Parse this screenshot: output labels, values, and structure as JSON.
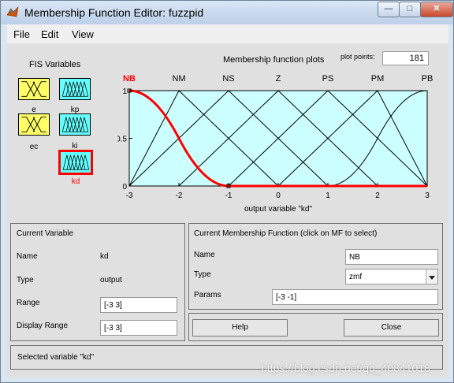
{
  "window": {
    "title": "Membership Function Editor: fuzzpid"
  },
  "title_buttons": {
    "minimize": "—",
    "maximize": "□",
    "close": "✕"
  },
  "menu": [
    {
      "label": "File"
    },
    {
      "label": "Edit"
    },
    {
      "label": "View"
    }
  ],
  "fis": {
    "title": "FIS Variables",
    "variables": [
      {
        "name": "e",
        "type": "input",
        "selected": false
      },
      {
        "name": "kp",
        "type": "output",
        "selected": false
      },
      {
        "name": "ec",
        "type": "input",
        "selected": false
      },
      {
        "name": "ki",
        "type": "output",
        "selected": false
      },
      {
        "name": "kd",
        "type": "output",
        "selected": true
      }
    ]
  },
  "plot": {
    "title": "Membership function plots",
    "plot_points_label": "plot points:",
    "plot_points_value": "181",
    "xlabel": "output variable \"kd\"",
    "colors": {
      "background": "#ccffff",
      "line": "#000000",
      "selected": "#ff0000"
    }
  },
  "chart_data": {
    "type": "line",
    "title": "Membership function plots",
    "xlabel": "output variable \"kd\"",
    "ylabel": "",
    "xlim": [
      -3,
      3
    ],
    "ylim": [
      0,
      1
    ],
    "xticks": [
      "-3",
      "-2",
      "-1",
      "0",
      "1",
      "2",
      "3"
    ],
    "yticks": [
      "0",
      "0.5",
      "1"
    ],
    "series": [
      {
        "name": "NB",
        "shape": "zmf",
        "params": [
          -3,
          -1
        ],
        "selected": true
      },
      {
        "name": "NM",
        "shape": "trimf",
        "params": [
          -3,
          -2,
          0
        ]
      },
      {
        "name": "NS",
        "shape": "trimf",
        "params": [
          -3,
          -1,
          1
        ]
      },
      {
        "name": "Z",
        "shape": "trimf",
        "params": [
          -2,
          0,
          2
        ]
      },
      {
        "name": "PS",
        "shape": "trimf",
        "params": [
          -1,
          1,
          3
        ]
      },
      {
        "name": "PM",
        "shape": "trimf",
        "params": [
          0,
          2,
          3
        ]
      },
      {
        "name": "PB",
        "shape": "smf",
        "params": [
          1,
          3
        ]
      }
    ]
  },
  "current_variable": {
    "title": "Current Variable",
    "name_label": "Name",
    "name_value": "kd",
    "type_label": "Type",
    "type_value": "output",
    "range_label": "Range",
    "range_value": "[-3 3]",
    "display_range_label": "Display Range",
    "display_range_value": "[-3 3]"
  },
  "current_mf": {
    "title": "Current Membership Function (click on MF to select)",
    "name_label": "Name",
    "name_value": "NB",
    "type_label": "Type",
    "type_value": "zmf",
    "params_label": "Params",
    "params_value": "[-3 -1]"
  },
  "buttons": {
    "help": "Help",
    "close": "Close"
  },
  "status": "Selected variable \"kd\"",
  "watermark": "https://blog.csdn.net/qq_40841018"
}
